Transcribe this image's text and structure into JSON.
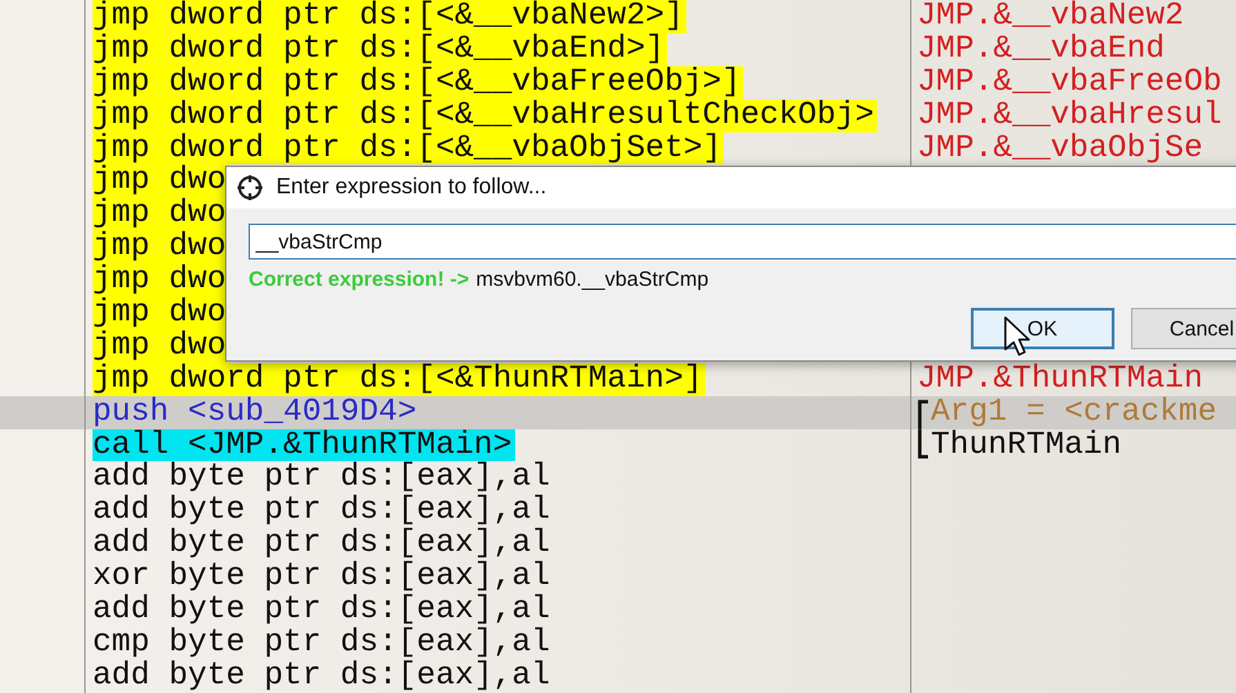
{
  "rows": [
    {
      "instruction": "jmp dword ptr ds:[<&__vbaNew2>]",
      "color": "#ffff00",
      "selected": false,
      "comment": {
        "text": "JMP.&__vbaNew2",
        "color": "#d42020"
      }
    },
    {
      "instruction": "jmp dword ptr ds:[<&__vbaEnd>]",
      "color": "#ffff00",
      "selected": false,
      "comment": {
        "text": "JMP.&__vbaEnd",
        "color": "#d42020"
      }
    },
    {
      "instruction": "jmp dword ptr ds:[<&__vbaFreeObj>]",
      "color": "#ffff00",
      "selected": false,
      "comment": {
        "text": "JMP.&__vbaFreeOb",
        "color": "#d42020"
      }
    },
    {
      "instruction": "jmp dword ptr ds:[<&__vbaHresultCheckObj>",
      "color": "#ffff00",
      "selected": false,
      "comment": {
        "text": "JMP.&__vbaHresul",
        "color": "#d42020"
      }
    },
    {
      "instruction": "jmp dword ptr ds:[<&__vbaObjSet>]",
      "color": "#ffff00",
      "selected": false,
      "comment": {
        "text": "JMP.&__vbaObjSe",
        "color": "#d42020"
      }
    },
    {
      "instruction": "jmp dwo",
      "color": "#ffff00",
      "selected": false
    },
    {
      "instruction": "jmp dwo",
      "color": "#ffff00",
      "selected": false
    },
    {
      "instruction": "jmp dwo",
      "color": "#ffff00",
      "selected": false
    },
    {
      "instruction": "jmp dwo",
      "color": "#ffff00",
      "selected": false
    },
    {
      "instruction": "jmp dwo",
      "color": "#ffff00",
      "selected": false
    },
    {
      "instruction": "jmp dwo",
      "color": "#ffff00",
      "selected": false
    },
    {
      "instruction": "jmp dword ptr ds:[<&ThunRTMain>]",
      "color": "#ffff00",
      "selected": false,
      "comment": {
        "text": "JMP.&ThunRTMain",
        "color": "#d42020"
      }
    },
    {
      "instruction": "push <sub_4019D4>",
      "selected": true,
      "comment": {
        "text": "Arg1 = <crackme",
        "color": "#b07a3a",
        "bracketed": true
      }
    },
    {
      "instruction": "call <JMP.&ThunRTMain>",
      "color": "#00e5f0",
      "selected": false,
      "comment": {
        "text": "ThunRTMain",
        "color": "#111111",
        "bracketed": true
      }
    },
    {
      "instruction": "add byte ptr ds:[eax],al",
      "selected": false
    },
    {
      "instruction": "add byte ptr ds:[eax],al",
      "selected": false
    },
    {
      "instruction": "add byte ptr ds:[eax],al",
      "selected": false
    },
    {
      "instruction": "xor byte ptr ds:[eax],al",
      "selected": false
    },
    {
      "instruction": "add byte ptr ds:[eax],al",
      "selected": false
    },
    {
      "instruction": "cmp byte ptr ds:[eax],al",
      "selected": false
    },
    {
      "instruction": "add byte ptr ds:[eax],al",
      "selected": false
    }
  ],
  "dialog": {
    "title": "Enter expression to follow...",
    "value": "__vbaStrCmp",
    "status": "Correct expression! ->",
    "result": "msvbvm60.__vbaStrCmp",
    "buttons": [
      {
        "label": "OK",
        "focused": true
      },
      {
        "label": "Cancel",
        "focused": false
      }
    ]
  }
}
